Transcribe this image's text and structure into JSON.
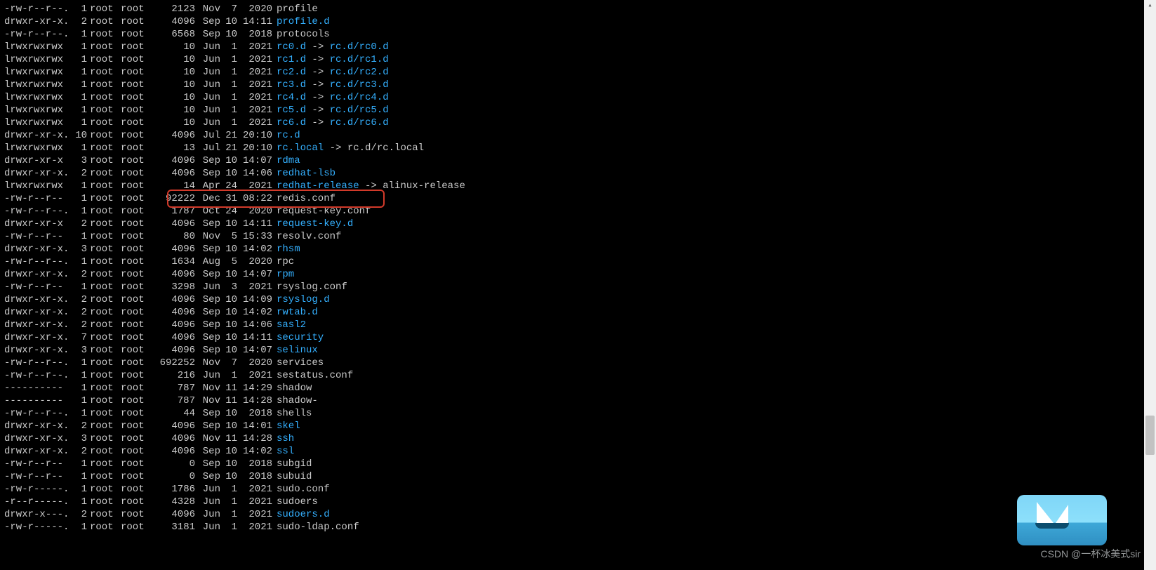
{
  "watermark": "CSDN @一杯冰美式sir",
  "rows": [
    {
      "perm": "-rw-r--r--.",
      "nlink": "1",
      "owner": "root",
      "group": "root",
      "size": "2123",
      "month": "Nov",
      "day": "7",
      "time": "2020",
      "name": "profile",
      "cls": ""
    },
    {
      "perm": "drwxr-xr-x.",
      "nlink": "2",
      "owner": "root",
      "group": "root",
      "size": "4096",
      "month": "Sep",
      "day": "10",
      "time": "14:11",
      "name": "profile.d",
      "cls": "dir"
    },
    {
      "perm": "-rw-r--r--.",
      "nlink": "1",
      "owner": "root",
      "group": "root",
      "size": "6568",
      "month": "Sep",
      "day": "10",
      "time": "2018",
      "name": "protocols",
      "cls": ""
    },
    {
      "perm": "lrwxrwxrwx",
      "nlink": "1",
      "owner": "root",
      "group": "root",
      "size": "10",
      "month": "Jun",
      "day": "1",
      "time": "2021",
      "name": "rc0.d",
      "cls": "link",
      "arrow": "->",
      "target": "rc.d/rc0.d",
      "tcls": "link"
    },
    {
      "perm": "lrwxrwxrwx",
      "nlink": "1",
      "owner": "root",
      "group": "root",
      "size": "10",
      "month": "Jun",
      "day": "1",
      "time": "2021",
      "name": "rc1.d",
      "cls": "link",
      "arrow": "->",
      "target": "rc.d/rc1.d",
      "tcls": "link"
    },
    {
      "perm": "lrwxrwxrwx",
      "nlink": "1",
      "owner": "root",
      "group": "root",
      "size": "10",
      "month": "Jun",
      "day": "1",
      "time": "2021",
      "name": "rc2.d",
      "cls": "link",
      "arrow": "->",
      "target": "rc.d/rc2.d",
      "tcls": "link"
    },
    {
      "perm": "lrwxrwxrwx",
      "nlink": "1",
      "owner": "root",
      "group": "root",
      "size": "10",
      "month": "Jun",
      "day": "1",
      "time": "2021",
      "name": "rc3.d",
      "cls": "link",
      "arrow": "->",
      "target": "rc.d/rc3.d",
      "tcls": "link"
    },
    {
      "perm": "lrwxrwxrwx",
      "nlink": "1",
      "owner": "root",
      "group": "root",
      "size": "10",
      "month": "Jun",
      "day": "1",
      "time": "2021",
      "name": "rc4.d",
      "cls": "link",
      "arrow": "->",
      "target": "rc.d/rc4.d",
      "tcls": "link"
    },
    {
      "perm": "lrwxrwxrwx",
      "nlink": "1",
      "owner": "root",
      "group": "root",
      "size": "10",
      "month": "Jun",
      "day": "1",
      "time": "2021",
      "name": "rc5.d",
      "cls": "link",
      "arrow": "->",
      "target": "rc.d/rc5.d",
      "tcls": "link"
    },
    {
      "perm": "lrwxrwxrwx",
      "nlink": "1",
      "owner": "root",
      "group": "root",
      "size": "10",
      "month": "Jun",
      "day": "1",
      "time": "2021",
      "name": "rc6.d",
      "cls": "link",
      "arrow": "->",
      "target": "rc.d/rc6.d",
      "tcls": "link"
    },
    {
      "perm": "drwxr-xr-x.",
      "nlink": "10",
      "owner": "root",
      "group": "root",
      "size": "4096",
      "month": "Jul",
      "day": "21",
      "time": "20:10",
      "name": "rc.d",
      "cls": "dir"
    },
    {
      "perm": "lrwxrwxrwx",
      "nlink": "1",
      "owner": "root",
      "group": "root",
      "size": "13",
      "month": "Jul",
      "day": "21",
      "time": "20:10",
      "name": "rc.local",
      "cls": "link",
      "arrow": "->",
      "target": "rc.d/rc.local",
      "tcls": ""
    },
    {
      "perm": "drwxr-xr-x",
      "nlink": "3",
      "owner": "root",
      "group": "root",
      "size": "4096",
      "month": "Sep",
      "day": "10",
      "time": "14:07",
      "name": "rdma",
      "cls": "dir"
    },
    {
      "perm": "drwxr-xr-x.",
      "nlink": "2",
      "owner": "root",
      "group": "root",
      "size": "4096",
      "month": "Sep",
      "day": "10",
      "time": "14:06",
      "name": "redhat-lsb",
      "cls": "dir"
    },
    {
      "perm": "lrwxrwxrwx",
      "nlink": "1",
      "owner": "root",
      "group": "root",
      "size": "14",
      "month": "Apr",
      "day": "24",
      "time": "2021",
      "name": "redhat-release",
      "cls": "link",
      "arrow": "->",
      "target": "alinux-release",
      "tcls": ""
    },
    {
      "perm": "-rw-r--r--",
      "nlink": "1",
      "owner": "root",
      "group": "root",
      "size": "92222",
      "month": "Dec",
      "day": "31",
      "time": "08:22",
      "name": "redis.conf",
      "cls": "",
      "hl": true
    },
    {
      "perm": "-rw-r--r--.",
      "nlink": "1",
      "owner": "root",
      "group": "root",
      "size": "1787",
      "month": "Oct",
      "day": "24",
      "time": "2020",
      "name": "request-key.conf",
      "cls": ""
    },
    {
      "perm": "drwxr-xr-x",
      "nlink": "2",
      "owner": "root",
      "group": "root",
      "size": "4096",
      "month": "Sep",
      "day": "10",
      "time": "14:11",
      "name": "request-key.d",
      "cls": "dir"
    },
    {
      "perm": "-rw-r--r--",
      "nlink": "1",
      "owner": "root",
      "group": "root",
      "size": "80",
      "month": "Nov",
      "day": "5",
      "time": "15:33",
      "name": "resolv.conf",
      "cls": ""
    },
    {
      "perm": "drwxr-xr-x.",
      "nlink": "3",
      "owner": "root",
      "group": "root",
      "size": "4096",
      "month": "Sep",
      "day": "10",
      "time": "14:02",
      "name": "rhsm",
      "cls": "dir"
    },
    {
      "perm": "-rw-r--r--.",
      "nlink": "1",
      "owner": "root",
      "group": "root",
      "size": "1634",
      "month": "Aug",
      "day": "5",
      "time": "2020",
      "name": "rpc",
      "cls": ""
    },
    {
      "perm": "drwxr-xr-x.",
      "nlink": "2",
      "owner": "root",
      "group": "root",
      "size": "4096",
      "month": "Sep",
      "day": "10",
      "time": "14:07",
      "name": "rpm",
      "cls": "dir"
    },
    {
      "perm": "-rw-r--r--",
      "nlink": "1",
      "owner": "root",
      "group": "root",
      "size": "3298",
      "month": "Jun",
      "day": "3",
      "time": "2021",
      "name": "rsyslog.conf",
      "cls": ""
    },
    {
      "perm": "drwxr-xr-x.",
      "nlink": "2",
      "owner": "root",
      "group": "root",
      "size": "4096",
      "month": "Sep",
      "day": "10",
      "time": "14:09",
      "name": "rsyslog.d",
      "cls": "dir"
    },
    {
      "perm": "drwxr-xr-x.",
      "nlink": "2",
      "owner": "root",
      "group": "root",
      "size": "4096",
      "month": "Sep",
      "day": "10",
      "time": "14:02",
      "name": "rwtab.d",
      "cls": "dir"
    },
    {
      "perm": "drwxr-xr-x.",
      "nlink": "2",
      "owner": "root",
      "group": "root",
      "size": "4096",
      "month": "Sep",
      "day": "10",
      "time": "14:06",
      "name": "sasl2",
      "cls": "dir"
    },
    {
      "perm": "drwxr-xr-x.",
      "nlink": "7",
      "owner": "root",
      "group": "root",
      "size": "4096",
      "month": "Sep",
      "day": "10",
      "time": "14:11",
      "name": "security",
      "cls": "dir"
    },
    {
      "perm": "drwxr-xr-x.",
      "nlink": "3",
      "owner": "root",
      "group": "root",
      "size": "4096",
      "month": "Sep",
      "day": "10",
      "time": "14:07",
      "name": "selinux",
      "cls": "dir"
    },
    {
      "perm": "-rw-r--r--.",
      "nlink": "1",
      "owner": "root",
      "group": "root",
      "size": "692252",
      "month": "Nov",
      "day": "7",
      "time": "2020",
      "name": "services",
      "cls": ""
    },
    {
      "perm": "-rw-r--r--.",
      "nlink": "1",
      "owner": "root",
      "group": "root",
      "size": "216",
      "month": "Jun",
      "day": "1",
      "time": "2021",
      "name": "sestatus.conf",
      "cls": ""
    },
    {
      "perm": "----------",
      "nlink": "1",
      "owner": "root",
      "group": "root",
      "size": "787",
      "month": "Nov",
      "day": "11",
      "time": "14:29",
      "name": "shadow",
      "cls": ""
    },
    {
      "perm": "----------",
      "nlink": "1",
      "owner": "root",
      "group": "root",
      "size": "787",
      "month": "Nov",
      "day": "11",
      "time": "14:28",
      "name": "shadow-",
      "cls": ""
    },
    {
      "perm": "-rw-r--r--.",
      "nlink": "1",
      "owner": "root",
      "group": "root",
      "size": "44",
      "month": "Sep",
      "day": "10",
      "time": "2018",
      "name": "shells",
      "cls": ""
    },
    {
      "perm": "drwxr-xr-x.",
      "nlink": "2",
      "owner": "root",
      "group": "root",
      "size": "4096",
      "month": "Sep",
      "day": "10",
      "time": "14:01",
      "name": "skel",
      "cls": "dir"
    },
    {
      "perm": "drwxr-xr-x.",
      "nlink": "3",
      "owner": "root",
      "group": "root",
      "size": "4096",
      "month": "Nov",
      "day": "11",
      "time": "14:28",
      "name": "ssh",
      "cls": "dir"
    },
    {
      "perm": "drwxr-xr-x.",
      "nlink": "2",
      "owner": "root",
      "group": "root",
      "size": "4096",
      "month": "Sep",
      "day": "10",
      "time": "14:02",
      "name": "ssl",
      "cls": "dir"
    },
    {
      "perm": "-rw-r--r--",
      "nlink": "1",
      "owner": "root",
      "group": "root",
      "size": "0",
      "month": "Sep",
      "day": "10",
      "time": "2018",
      "name": "subgid",
      "cls": ""
    },
    {
      "perm": "-rw-r--r--",
      "nlink": "1",
      "owner": "root",
      "group": "root",
      "size": "0",
      "month": "Sep",
      "day": "10",
      "time": "2018",
      "name": "subuid",
      "cls": ""
    },
    {
      "perm": "-rw-r-----.",
      "nlink": "1",
      "owner": "root",
      "group": "root",
      "size": "1786",
      "month": "Jun",
      "day": "1",
      "time": "2021",
      "name": "sudo.conf",
      "cls": ""
    },
    {
      "perm": "-r--r-----.",
      "nlink": "1",
      "owner": "root",
      "group": "root",
      "size": "4328",
      "month": "Jun",
      "day": "1",
      "time": "2021",
      "name": "sudoers",
      "cls": ""
    },
    {
      "perm": "drwxr-x---.",
      "nlink": "2",
      "owner": "root",
      "group": "root",
      "size": "4096",
      "month": "Jun",
      "day": "1",
      "time": "2021",
      "name": "sudoers.d",
      "cls": "dir"
    },
    {
      "perm": "-rw-r-----.",
      "nlink": "1",
      "owner": "root",
      "group": "root",
      "size": "3181",
      "month": "Jun",
      "day": "1",
      "time": "2021",
      "name": "sudo-ldap.conf",
      "cls": ""
    }
  ]
}
